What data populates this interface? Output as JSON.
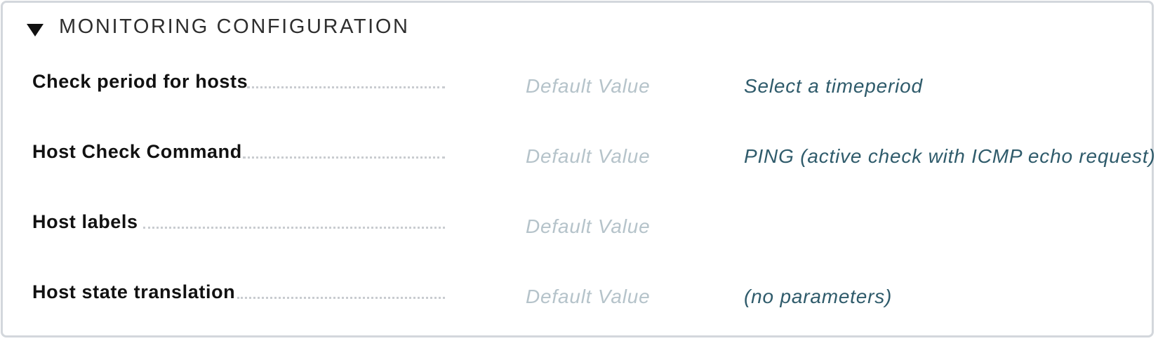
{
  "section": {
    "title": "MONITORING CONFIGURATION",
    "expanded": true
  },
  "rows": [
    {
      "label": "Check period for hosts",
      "default": "Default Value",
      "value": "Select a timeperiod"
    },
    {
      "label": "Host Check Command",
      "default": "Default Value",
      "value": "PING (active check with ICMP echo request)"
    },
    {
      "label": "Host labels",
      "default": "Default Value",
      "value": ""
    },
    {
      "label": "Host state translation",
      "default": "Default Value",
      "value": "(no parameters)"
    }
  ],
  "colors": {
    "default_text": "#b5c3ca",
    "value_text": "#2f5b6b",
    "border": "#d3d7dc"
  }
}
